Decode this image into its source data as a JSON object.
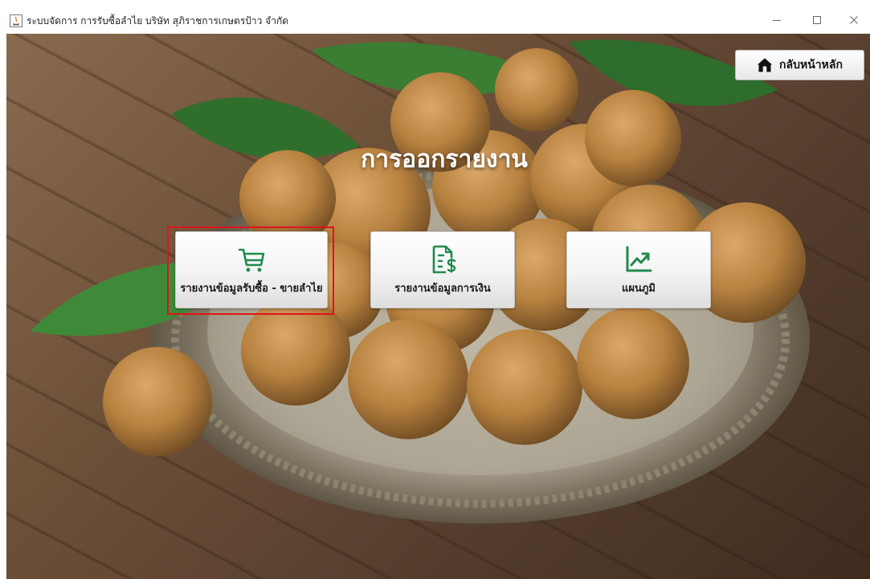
{
  "window": {
    "title": "ระบบจัดการ การรับซื้อลำไย บริษัท สุภิราชการเกษตรป้าว จำกัด",
    "controls": {
      "minimize_icon": "minimize-icon",
      "maximize_icon": "maximize-icon",
      "close_icon": "close-icon"
    }
  },
  "header": {
    "home_button_label": "กลับหน้าหลัก",
    "home_icon": "home-icon"
  },
  "page": {
    "title": "การออกรายงาน"
  },
  "menu": {
    "buttons": [
      {
        "label": "รายงานข้อมูลรับซื้อ - ขายลำไย",
        "icon": "shopping-cart-icon",
        "focused": true
      },
      {
        "label": "รายงานข้อมูลการเงิน",
        "icon": "finance-document-icon",
        "focused": false
      },
      {
        "label": "แผนภูมิ",
        "icon": "line-chart-icon",
        "focused": false
      }
    ]
  },
  "colors": {
    "icon_green": "#1f8a4c",
    "focus_red": "#e0141a",
    "title_text": "#ffffff"
  }
}
